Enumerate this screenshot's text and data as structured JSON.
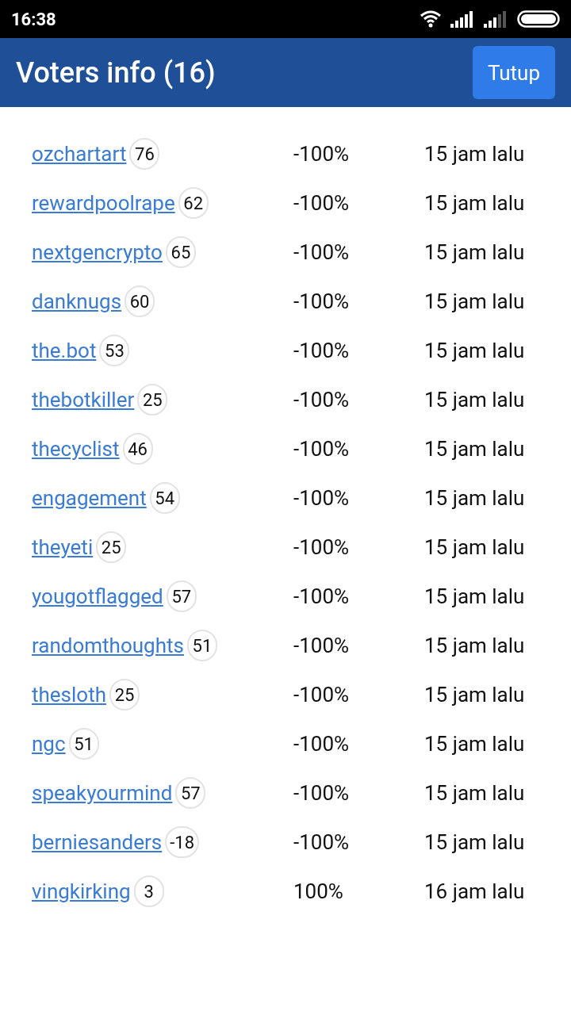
{
  "status_bar": {
    "time": "16:38"
  },
  "header": {
    "title": "Voters info (16)",
    "close_button": "Tutup"
  },
  "voters": [
    {
      "name": "ozchartart",
      "reputation": "76",
      "percent": "-100%",
      "time": "15 jam lalu"
    },
    {
      "name": "rewardpoolrape",
      "reputation": "62",
      "percent": "-100%",
      "time": "15 jam lalu"
    },
    {
      "name": "nextgencrypto",
      "reputation": "65",
      "percent": "-100%",
      "time": "15 jam lalu"
    },
    {
      "name": "danknugs",
      "reputation": "60",
      "percent": "-100%",
      "time": "15 jam lalu"
    },
    {
      "name": "the.bot",
      "reputation": "53",
      "percent": "-100%",
      "time": "15 jam lalu"
    },
    {
      "name": "thebotkiller",
      "reputation": "25",
      "percent": "-100%",
      "time": "15 jam lalu"
    },
    {
      "name": "thecyclist",
      "reputation": "46",
      "percent": "-100%",
      "time": "15 jam lalu"
    },
    {
      "name": "engagement",
      "reputation": "54",
      "percent": "-100%",
      "time": "15 jam lalu"
    },
    {
      "name": "theyeti",
      "reputation": "25",
      "percent": "-100%",
      "time": "15 jam lalu"
    },
    {
      "name": "yougotflagged",
      "reputation": "57",
      "percent": "-100%",
      "time": "15 jam lalu"
    },
    {
      "name": "randomthoughts",
      "reputation": "51",
      "percent": "-100%",
      "time": "15 jam lalu"
    },
    {
      "name": "thesloth",
      "reputation": "25",
      "percent": "-100%",
      "time": "15 jam lalu"
    },
    {
      "name": "ngc",
      "reputation": "51",
      "percent": "-100%",
      "time": "15 jam lalu"
    },
    {
      "name": "speakyourmind",
      "reputation": "57",
      "percent": "-100%",
      "time": "15 jam lalu"
    },
    {
      "name": "berniesanders",
      "reputation": "-18",
      "percent": "-100%",
      "time": "15 jam lalu"
    },
    {
      "name": "vingkirking",
      "reputation": "3",
      "percent": "100%",
      "time": "16 jam lalu"
    }
  ]
}
